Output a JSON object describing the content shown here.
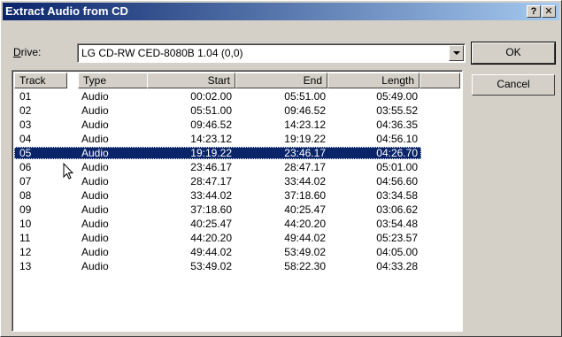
{
  "window": {
    "title": "Extract Audio from CD",
    "help_label": "?",
    "close_label": "✕"
  },
  "drive": {
    "label_prefix": "D",
    "label_rest": "rive:",
    "value": "LG CD-RW CED-8080B 1.04 (0,0)"
  },
  "buttons": {
    "ok": "OK",
    "cancel": "Cancel"
  },
  "table": {
    "columns": [
      "Track",
      "Type",
      "Start",
      "End",
      "Length"
    ],
    "selected_index": 4,
    "rows": [
      {
        "track": "01",
        "type": "Audio",
        "start": "00:02.00",
        "end": "05:51.00",
        "length": "05:49.00"
      },
      {
        "track": "02",
        "type": "Audio",
        "start": "05:51.00",
        "end": "09:46.52",
        "length": "03:55.52"
      },
      {
        "track": "03",
        "type": "Audio",
        "start": "09:46.52",
        "end": "14:23.12",
        "length": "04:36.35"
      },
      {
        "track": "04",
        "type": "Audio",
        "start": "14:23.12",
        "end": "19:19.22",
        "length": "04:56.10"
      },
      {
        "track": "05",
        "type": "Audio",
        "start": "19:19.22",
        "end": "23:46.17",
        "length": "04:26.70"
      },
      {
        "track": "06",
        "type": "Audio",
        "start": "23:46.17",
        "end": "28:47.17",
        "length": "05:01.00"
      },
      {
        "track": "07",
        "type": "Audio",
        "start": "28:47.17",
        "end": "33:44.02",
        "length": "04:56.60"
      },
      {
        "track": "08",
        "type": "Audio",
        "start": "33:44.02",
        "end": "37:18.60",
        "length": "03:34.58"
      },
      {
        "track": "09",
        "type": "Audio",
        "start": "37:18.60",
        "end": "40:25.47",
        "length": "03:06.62"
      },
      {
        "track": "10",
        "type": "Audio",
        "start": "40:25.47",
        "end": "44:20.20",
        "length": "03:54.48"
      },
      {
        "track": "11",
        "type": "Audio",
        "start": "44:20.20",
        "end": "49:44.02",
        "length": "05:23.57"
      },
      {
        "track": "12",
        "type": "Audio",
        "start": "49:44.02",
        "end": "53:49.02",
        "length": "04:05.00"
      },
      {
        "track": "13",
        "type": "Audio",
        "start": "53:49.02",
        "end": "58:22.30",
        "length": "04:33.28"
      }
    ]
  },
  "colors": {
    "title_start": "#0a246a",
    "title_end": "#a6caf0",
    "selection": "#0a246a",
    "face": "#d4d0c8"
  }
}
